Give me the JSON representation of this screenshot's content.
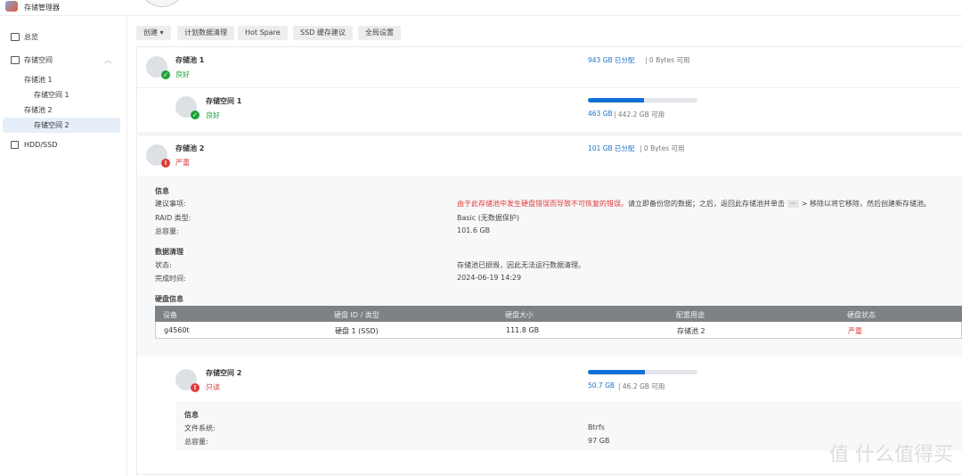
{
  "app": {
    "title": "存储管理器"
  },
  "sidebar": {
    "items": [
      {
        "label": "总览"
      },
      {
        "label": "存储空间"
      },
      {
        "label": "存储池 1"
      },
      {
        "label": "存储空间 1"
      },
      {
        "label": "存储池 2"
      },
      {
        "label": "存储空间 2"
      },
      {
        "label": "HDD/SSD"
      }
    ]
  },
  "toolbar": {
    "create": "创建 ▾",
    "scrub": "计划数据清理",
    "hotspare": "Hot Spare",
    "ssd": "SSD 缓存建议",
    "global": "全局设置"
  },
  "pool1": {
    "name": "存储池 1",
    "status": "良好",
    "allocated": "943 GB 已分配",
    "available": "| 0 Bytes 可用"
  },
  "volume1": {
    "name": "存储空间 1",
    "status": "良好",
    "used": "463 GB",
    "free": "| 442.2 GB 可用",
    "usage_percent": 51
  },
  "pool2": {
    "name": "存储池 2",
    "status": "严重",
    "allocated": "101 GB 已分配",
    "available": "| 0 Bytes 可用",
    "info_title": "信息",
    "advice_label": "建议事项:",
    "advice_red": "由于此存储池中发生硬盘错误而导致不可恢复的错误。",
    "advice_rest": "请立即备份您的数据；之后，返回此存储池并单击",
    "advice_btn": "···",
    "advice_end": "> 移除以将它移除，然后创建新存储池。",
    "raid_label": "RAID 类型:",
    "raid": "Basic (无数据保护)",
    "cap_label": "总容量:",
    "cap": "101.6 GB",
    "scrub_title": "数据清理",
    "state_label": "状态:",
    "state": "存储池已损毁，因此无法运行数据清理。",
    "done_label": "完成时间:",
    "done": "2024-06-19 14:29",
    "disk_title": "硬盘信息",
    "cols": [
      "设备",
      "硬盘 ID / 类型",
      "硬盘大小",
      "配置用途",
      "硬盘状态"
    ],
    "row": [
      "g4560t",
      "硬盘 1 (SSD)",
      "111.8 GB",
      "存储池 2",
      "严重"
    ]
  },
  "volume2": {
    "name": "存储空间 2",
    "status": "只读",
    "used": "50.7 GB",
    "free": "| 46.2 GB 可用",
    "usage_percent": 52,
    "info_title": "信息",
    "fs_label": "文件系统:",
    "fs": "Btrfs",
    "cap_label": "总容量:",
    "cap": "97 GB"
  },
  "watermark": "值 什么值得买"
}
